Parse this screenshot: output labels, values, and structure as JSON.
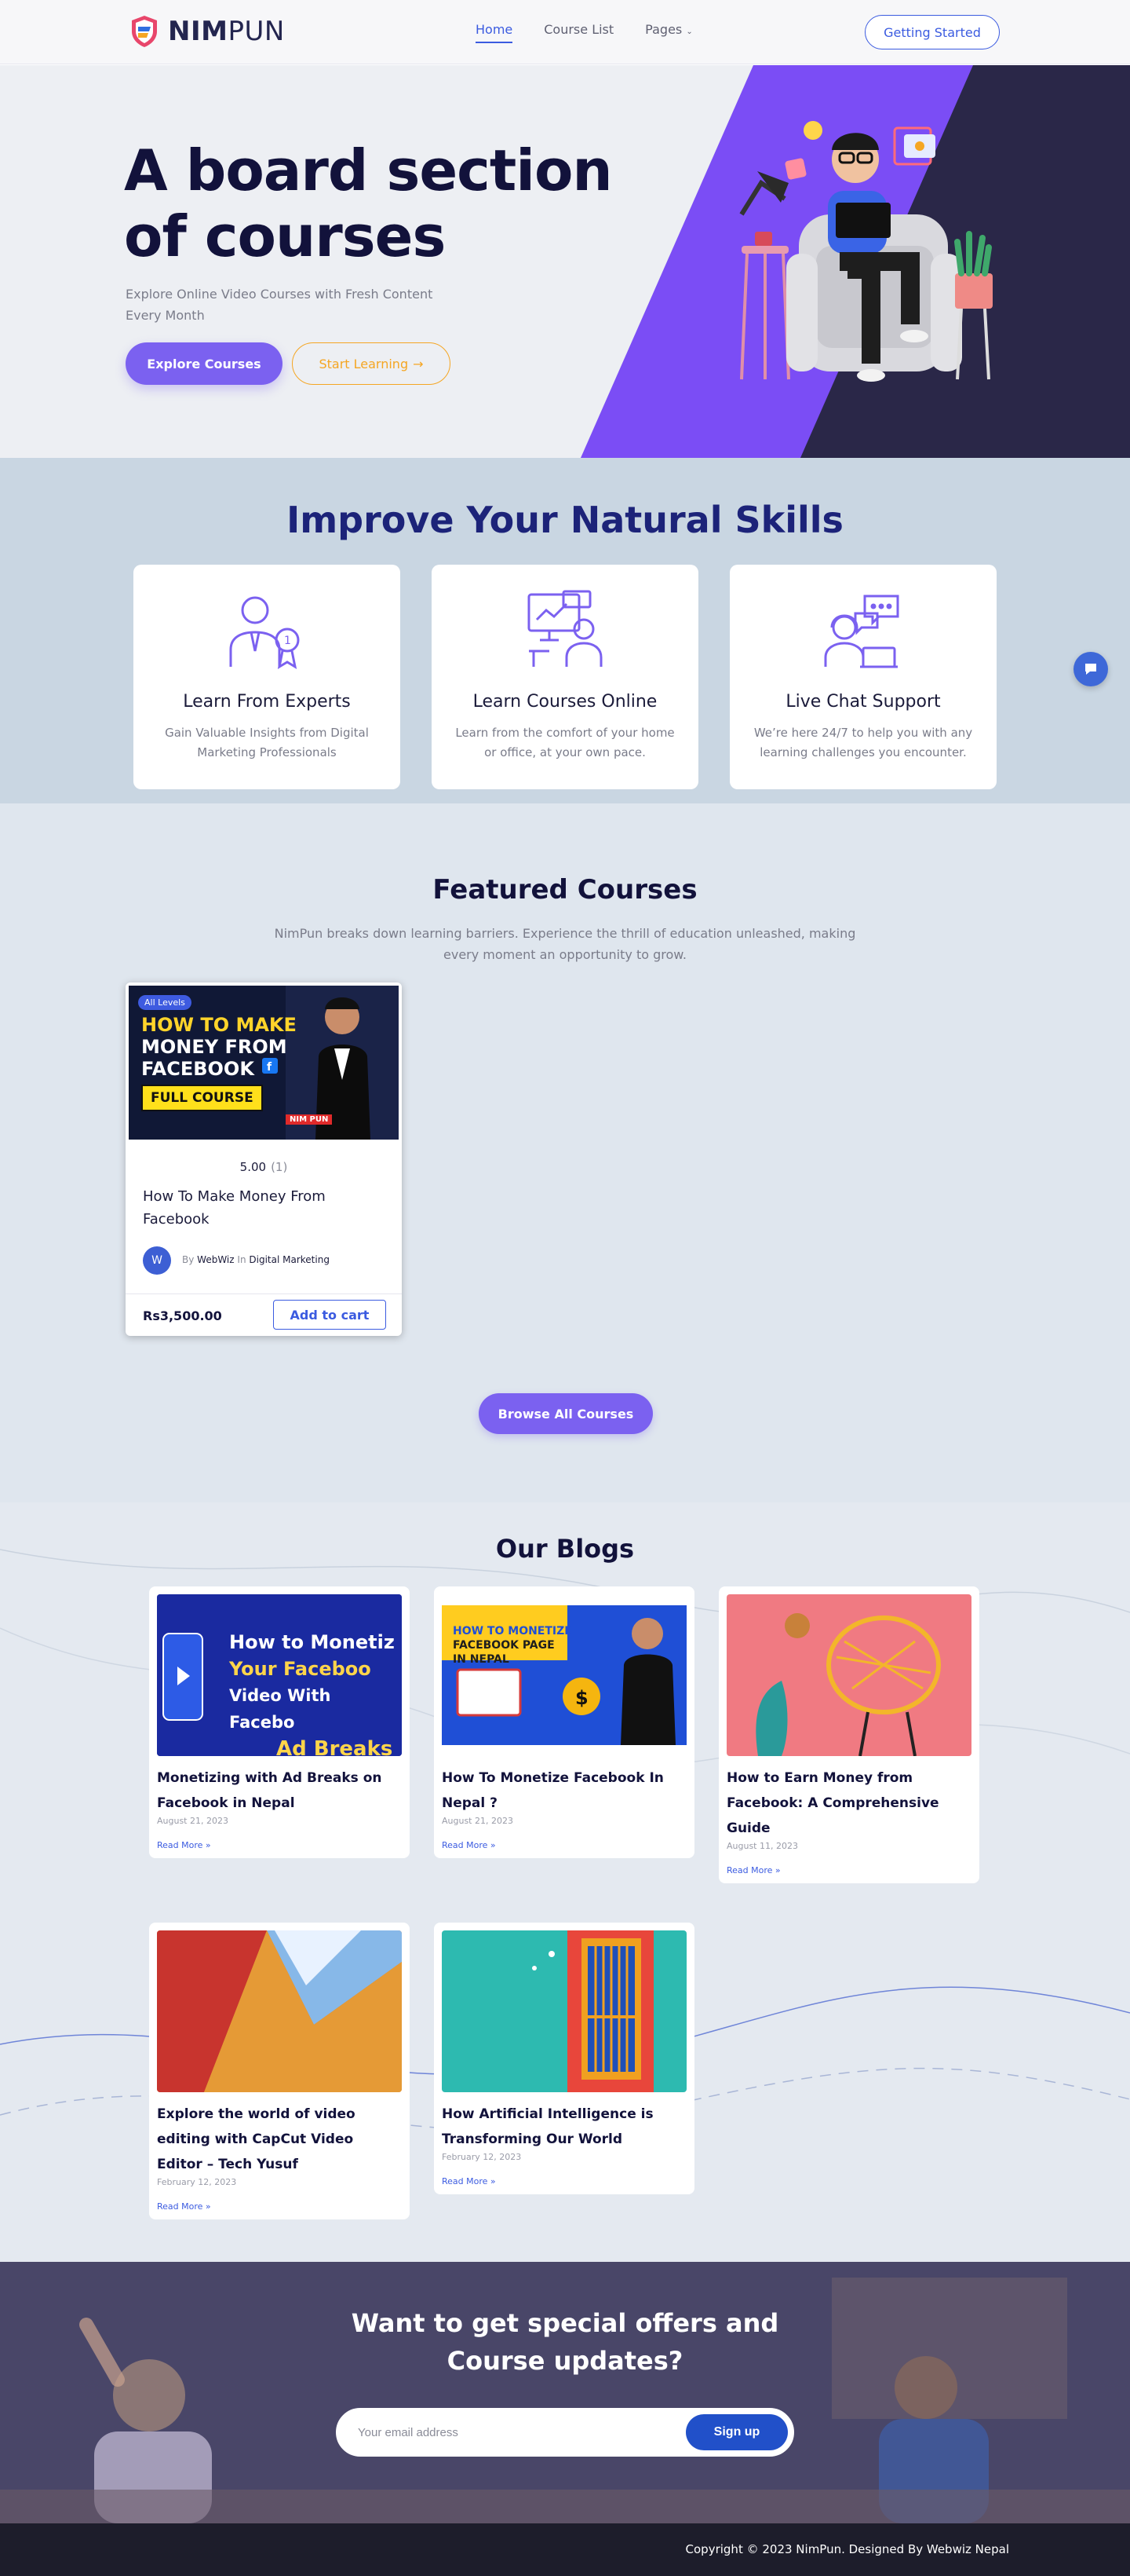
{
  "brand": {
    "logo_bold": "NIM",
    "logo_light": "PUN"
  },
  "nav": {
    "items": [
      {
        "label": "Home",
        "active": true
      },
      {
        "label": "Course List",
        "active": false
      },
      {
        "label": "Pages",
        "active": false,
        "caret": "chevron-down-icon"
      }
    ],
    "cta_label": "Getting Started"
  },
  "hero": {
    "title": "A board section of courses",
    "subtitle": "Explore Online Video Courses with Fresh Content Every Month",
    "primary_label": "Explore Courses",
    "secondary_label": "Start Learning",
    "secondary_icon": "arrow-right-icon"
  },
  "skills": {
    "title": "Improve Your Natural Skills",
    "cards": [
      {
        "icon": "expert-award-icon",
        "title": "Learn From Experts",
        "desc": "Gain Valuable Insights from Digital Marketing Professionals"
      },
      {
        "icon": "online-presentation-icon",
        "title": "Learn Courses Online",
        "desc": "Learn from the comfort of your home or office, at your own pace."
      },
      {
        "icon": "support-headset-icon",
        "title": "Live Chat Support",
        "desc": "We’re here 24/7 to help you with any learning challenges you encounter."
      }
    ]
  },
  "featured": {
    "title": "Featured Courses",
    "subtitle": "NimPun breaks down learning barriers. Experience the thrill of education unleashed, making every moment an opportunity to grow.",
    "course": {
      "badge": "All Levels",
      "thumb_line1": "HOW TO MAKE",
      "thumb_line2": "MONEY FROM",
      "thumb_line3": "FACEBOOK",
      "thumb_pill": "FULL COURSE",
      "thumb_brand": "NIM PUN",
      "rating": "5.00",
      "rating_count": "(1)",
      "title": "How To Make Money From Facebook",
      "author_initial": "W",
      "by_label": "By",
      "author": "WebWiz",
      "in_label": "In",
      "category": "Digital Marketing",
      "price": "Rs3,500.00",
      "cart_label": "Add to cart"
    },
    "browse_label": "Browse All Courses"
  },
  "blogs": {
    "title": "Our Blogs",
    "posts": [
      {
        "title": "Monetizing with Ad Breaks on Facebook in Nepal",
        "date": "August 21, 2023",
        "more": "Read More »",
        "img_text": "How to Monetiz Your Faceboo Video With Facebo Ad Breaks"
      },
      {
        "title": "How To Monetize Facebook In Nepal ?",
        "date": "August 21, 2023",
        "more": "Read More »",
        "img_text": "HOW TO MONETIZE FACEBOOK PAGE IN NEPAL"
      },
      {
        "title": "How to Earn Money from Facebook: A Comprehensive Guide",
        "date": "August 11, 2023",
        "more": "Read More »"
      },
      {
        "title": "Explore the world of video editing with CapCut Video Editor – Tech Yusuf",
        "date": "February 12, 2023",
        "more": "Read More »"
      },
      {
        "title": "How Artificial Intelligence is Transforming Our World",
        "date": "February 12, 2023",
        "more": "Read More »"
      }
    ]
  },
  "newsletter": {
    "title": "Want to get special offers and Course updates?",
    "placeholder": "Your email address",
    "button": "Sign up"
  },
  "footer": {
    "copyright": "Copyright © 2023 NimPun. Designed By Webwiz Nepal"
  },
  "colors": {
    "accent": "#7b61f0",
    "link": "#3b5be0",
    "navy": "#12123b",
    "orange": "#f5a623"
  }
}
